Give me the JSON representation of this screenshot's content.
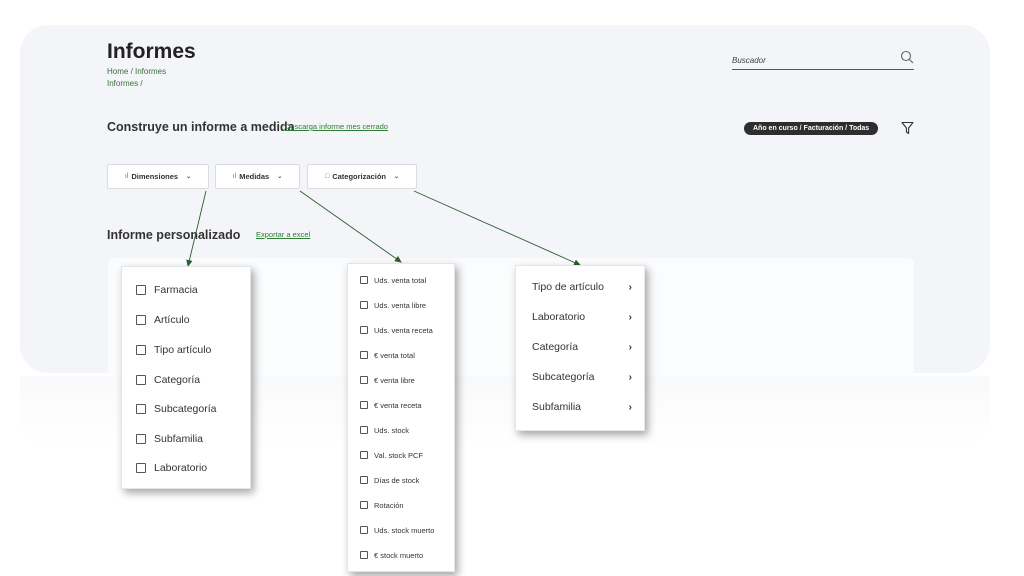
{
  "header": {
    "title": "Informes",
    "breadcrumb_line1": "Home / Informes",
    "breadcrumb_line2": "Informes /"
  },
  "search": {
    "placeholder": "Buscador",
    "icon": "search-icon"
  },
  "builder": {
    "title": "Construye un informe a medida",
    "download_link": "Descarga informe mes cerrado",
    "active_filter": "Año en curso / Facturación / Todas",
    "filter_icon": "funnel-icon"
  },
  "tabs": [
    {
      "label": "Dimensiones",
      "icon": "bar-chart-icon"
    },
    {
      "label": "Medidas",
      "icon": "bar-chart-icon"
    },
    {
      "label": "Categorización",
      "icon": "bookmark-icon"
    }
  ],
  "report": {
    "title": "Informe personalizado",
    "export_link": "Exportar a excel"
  },
  "dimensions_menu": [
    "Farmacia",
    "Artículo",
    "Tipo artículo",
    "Categoría",
    "Subcategoría",
    "Subfamilia",
    "Laboratorio"
  ],
  "measures_menu": [
    "Uds. venta total",
    "Uds. venta libre",
    "Uds. venta receta",
    "€ venta total",
    "€ venta libre",
    "€ venta receta",
    "Uds. stock",
    "Val. stock PCF",
    "Días de stock",
    "Rotación",
    "Uds. stock muerto",
    "€ stock muerto"
  ],
  "categorization_menu": [
    "Tipo de artículo",
    "Laboratorio",
    "Categoría",
    "Subcategoría",
    "Subfamilia"
  ],
  "colors": {
    "accent": "#2e7d32",
    "annotation_arrow": "#2f5e2f",
    "pill_bg": "#2e2e2e",
    "panel_bg": "#f3f5f8"
  }
}
